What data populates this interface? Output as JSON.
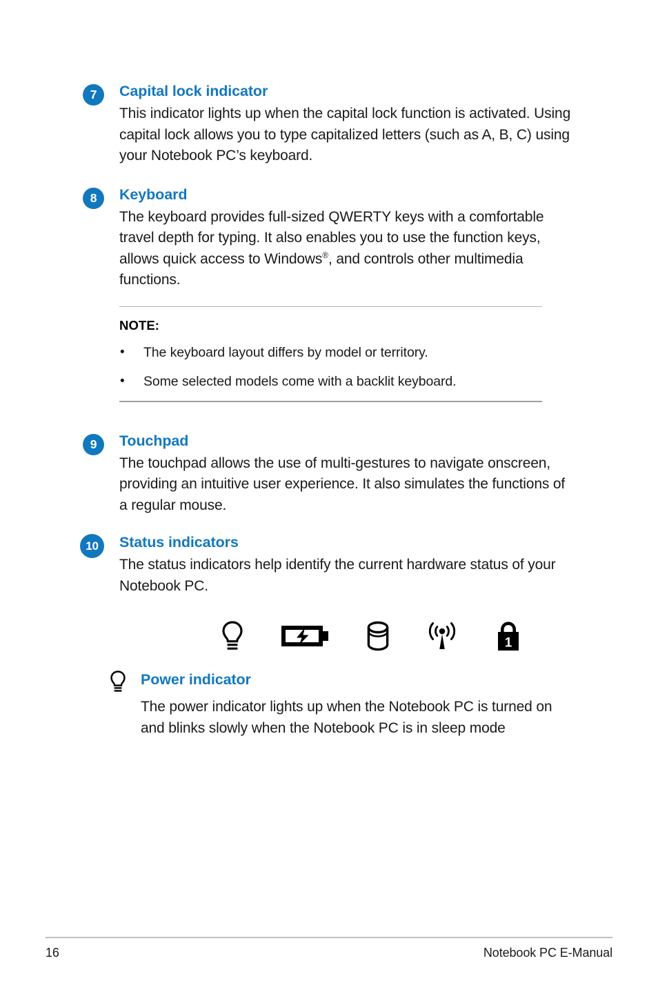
{
  "page": {
    "number": "16",
    "footer_title": "Notebook PC E-Manual",
    "accent_color": "#1278be",
    "text_color": "#1a1a1a"
  },
  "sections": [
    {
      "number": "7",
      "title": "Capital lock indicator",
      "body": "This indicator lights up when the capital lock function is activated. Using capital lock allows you to type capitalized letters (such as A, B, C) using your Notebook PC’s keyboard."
    },
    {
      "number": "8",
      "title": "Keyboard",
      "body_before": "The keyboard provides full-sized QWERTY keys with a comfortable travel depth for typing. It also enables you to use the function keys, allows quick access to Windows",
      "body_sup": "®",
      "body_after": ", and controls other multimedia functions."
    },
    {
      "number": "9",
      "title": "Touchpad",
      "body": "The touchpad allows the use of multi-gestures to navigate onscreen, providing an intuitive user experience. It also simulates the functions of a regular mouse."
    },
    {
      "number": "10",
      "title": "Status indicators",
      "body": "The status indicators help identify the current hardware status of your Notebook PC."
    }
  ],
  "note": {
    "label": "NOTE:",
    "bullet_glyph": "•",
    "items": [
      "The keyboard layout differs by model or territory.",
      "Some selected models come with a backlit keyboard."
    ]
  },
  "status_icons": [
    {
      "name": "power-indicator-icon",
      "label": "power indicator"
    },
    {
      "name": "battery-charge-icon",
      "label": "two-color battery charge indicator"
    },
    {
      "name": "drive-activity-icon",
      "label": "drive activity indicator"
    },
    {
      "name": "wireless-bluetooth-icon",
      "label": "bluetooth / wireless indicator"
    },
    {
      "name": "number-lock-icon",
      "label": "number lock indicator",
      "glyph": "1"
    }
  ],
  "power_indicator": {
    "title": "Power indicator",
    "body": "The power indicator lights up when the Notebook PC is turned on and blinks slowly when the Notebook PC is in sleep mode"
  }
}
